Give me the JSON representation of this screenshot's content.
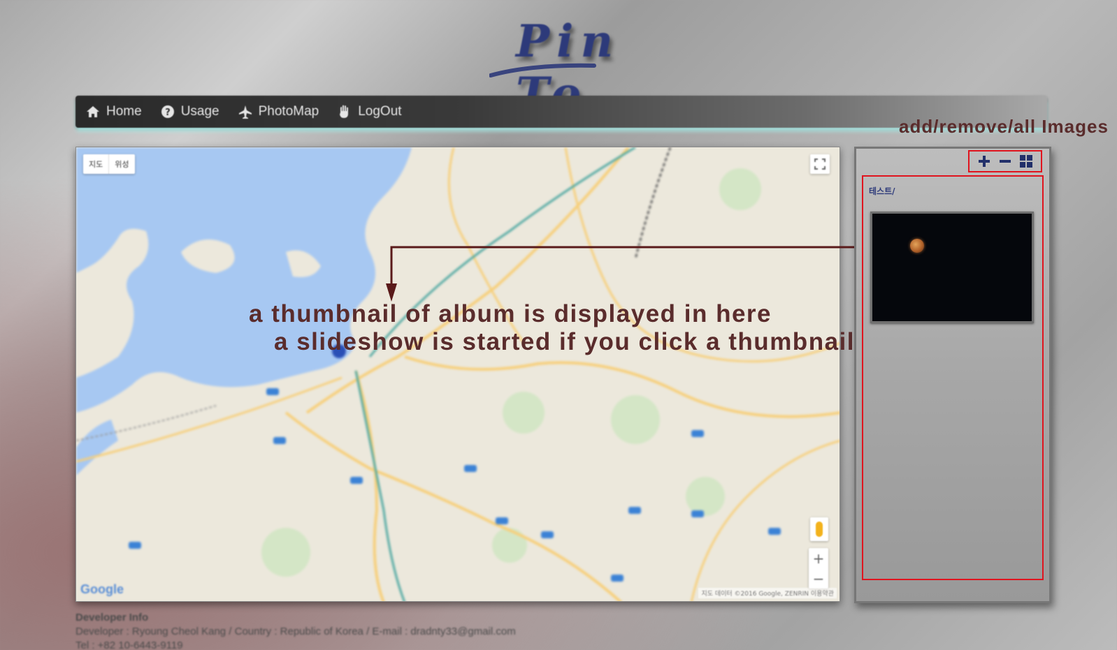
{
  "logo": {
    "text": "Pin To"
  },
  "nav": {
    "items": [
      {
        "label": "Home",
        "icon": "home-icon"
      },
      {
        "label": "Usage",
        "icon": "question-icon"
      },
      {
        "label": "PhotoMap",
        "icon": "plane-icon"
      },
      {
        "label": "LogOut",
        "icon": "hand-icon"
      }
    ]
  },
  "annotations": {
    "tools": "add/remove/all Images",
    "thumb_line1": "a thumbnail of album is displayed in here",
    "thumb_line2": "a slideshow is started if you click a thumbnail"
  },
  "map": {
    "type_controls": [
      "지도",
      "위성"
    ],
    "google_logo": "Google",
    "attribution": "지도 데이터 ©2016 Google, ZENRIN  이용약관"
  },
  "sidebar": {
    "tools": [
      {
        "name": "add-image-button",
        "icon": "plus-icon"
      },
      {
        "name": "remove-image-button",
        "icon": "minus-icon"
      },
      {
        "name": "all-images-button",
        "icon": "grid-icon"
      }
    ],
    "album": {
      "name": "테스트/"
    }
  },
  "footer": {
    "title": "Developer Info",
    "line1": "Developer : Ryoung Cheol Kang / Country : Republic of Korea / E-mail : dradnty33@gmail.com",
    "line2": "Tel : +82 10-6443-9119"
  },
  "colors": {
    "annotation": "#5a2c2c",
    "highlight_border": "#e0141e",
    "logo": "#2d3a7a",
    "nav_glow": "#a8e3df"
  }
}
